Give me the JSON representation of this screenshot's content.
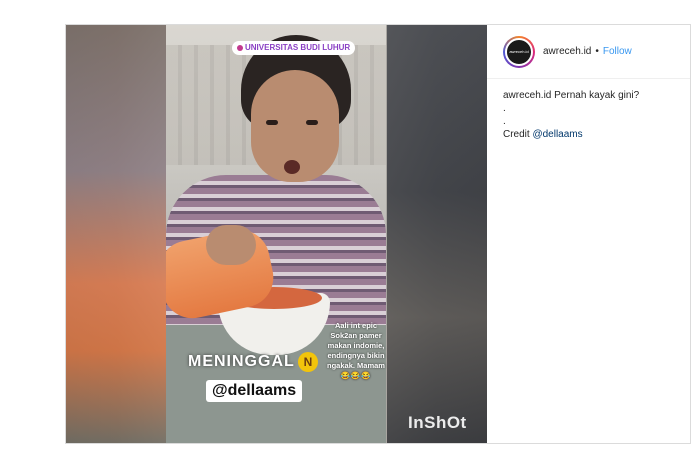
{
  "post": {
    "username": "awreceh.id",
    "separator": "•",
    "follow_label": "Follow",
    "avatar_text": "awreceh.id",
    "caption_text": "Pernah kayak gini?",
    "caption_lines": [
      ".",
      "."
    ],
    "credit_label": "Credit",
    "credit_mention": "@dellaams"
  },
  "video": {
    "location_label": "UNIVERSITAS BUDI LUHUR",
    "headline": "MENINGGAL",
    "headline_icon": "N",
    "mention": "@dellaams",
    "overlay_lines": [
      "Aali int epic",
      "Sok2an pamer",
      "makan indomie,",
      "endingnya bikin",
      "ngakak. Mamam"
    ],
    "overlay_emojis": "😂😂😂",
    "watermark": "InShOt"
  },
  "colors": {
    "follow": "#3897f0",
    "mention": "#00376b",
    "location_text": "#8a3fc4"
  }
}
